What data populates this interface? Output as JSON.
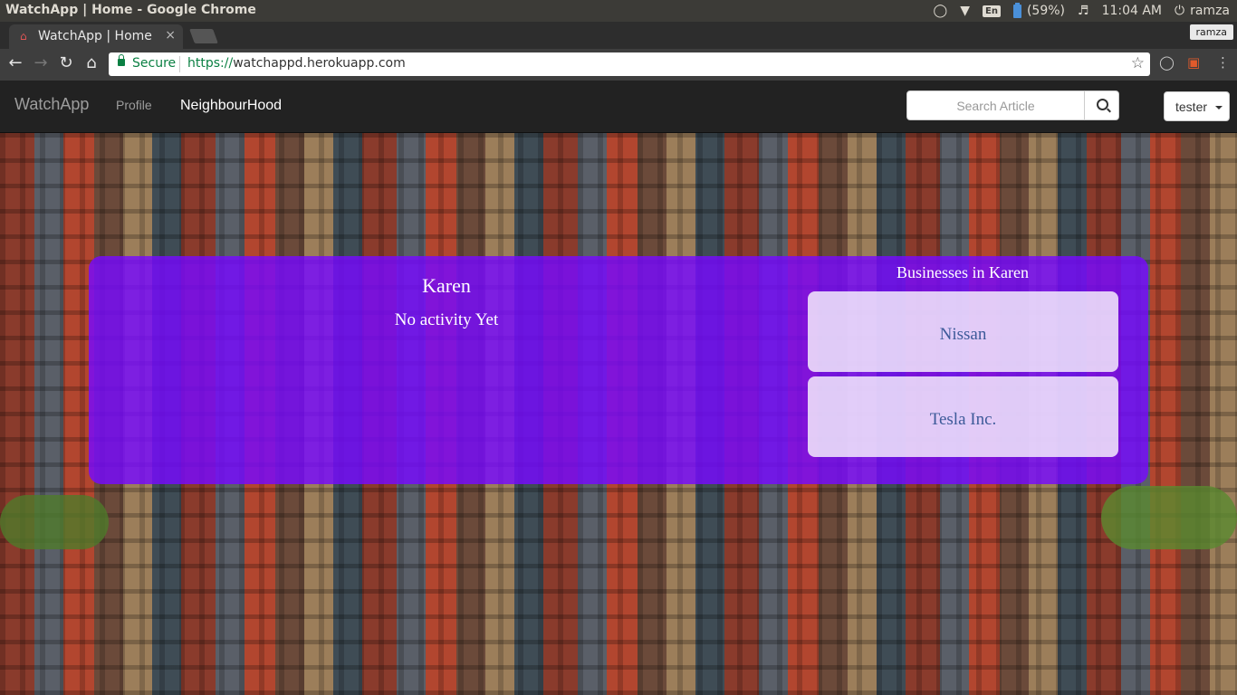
{
  "os": {
    "window_title": "WatchApp | Home - Google Chrome",
    "keyboard": "En",
    "battery": "(59%)",
    "time": "11:04 AM",
    "user": "ramza"
  },
  "browser": {
    "tab_title": "WatchApp | Home",
    "tab_close": "×",
    "profile_chip": "ramza",
    "secure_label": "Secure",
    "url_scheme": "https://",
    "url_host": "watchappd.herokuapp.com"
  },
  "navbar": {
    "brand": "WatchApp",
    "profile": "Profile",
    "neighbourhood": "NeighbourHood",
    "search_placeholder": "Search Article",
    "user_menu": "tester"
  },
  "neighbourhood": {
    "name": "Karen",
    "activity": "No activity Yet",
    "businesses_heading": "Businesses in Karen",
    "businesses": [
      {
        "name": "Nissan"
      },
      {
        "name": "Tesla Inc."
      }
    ]
  },
  "colors": {
    "panel": "#760aff",
    "navbar": "#222222",
    "business_link": "#3d5a99"
  }
}
